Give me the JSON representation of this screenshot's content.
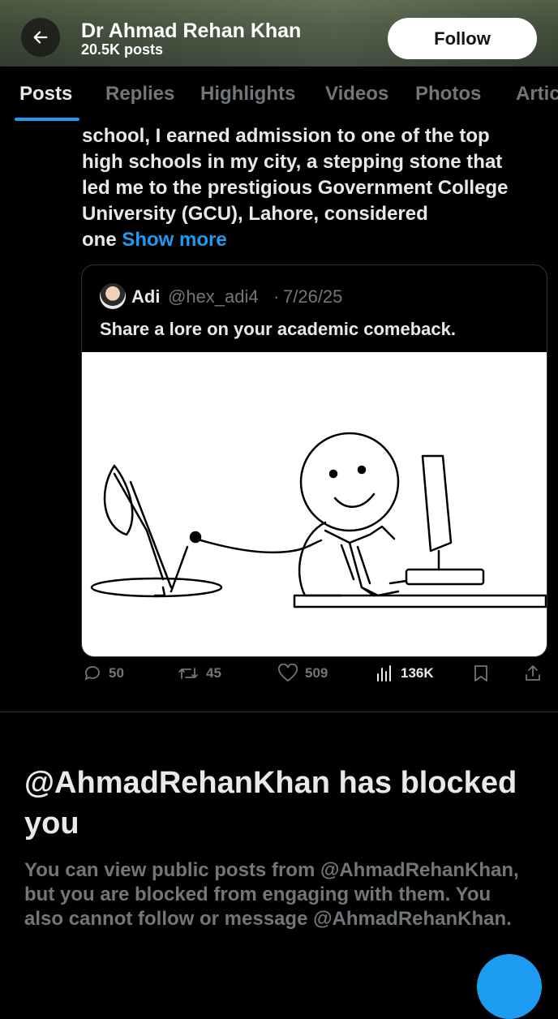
{
  "header": {
    "name": "Dr Ahmad Rehan Khan",
    "posts_count": "20.5K posts",
    "follow_label": "Follow"
  },
  "tabs": [
    {
      "label": "Posts",
      "active": true
    },
    {
      "label": "Replies",
      "active": false
    },
    {
      "label": "Highlights",
      "active": false
    },
    {
      "label": "Videos",
      "active": false
    },
    {
      "label": "Photos",
      "active": false
    },
    {
      "label": "Artic",
      "active": false
    }
  ],
  "post": {
    "lines": [
      "school, I earned admission to one of the top",
      "high schools in my city, a stepping stone that",
      "led me to the prestigious Government College",
      "University (GCU), Lahore, considered"
    ],
    "last_word": "one",
    "show_more": "Show more"
  },
  "quote": {
    "name": "Adi",
    "handle": "@hex_adi4",
    "dot": "·",
    "date": "7/26/25",
    "text": "Share a lore on your academic comeback."
  },
  "actions": {
    "replies": "50",
    "reposts": "45",
    "likes": "509",
    "views": "136K"
  },
  "blocked": {
    "title": "@AhmadRehanKhan has blocked you",
    "description": "You can view public posts from @AhmadRehanKhan, but you are blocked from engaging with them. You also cannot follow or message @AhmadRehanKhan."
  },
  "colors": {
    "accent": "#1d9bf0",
    "muted": "#71767b",
    "text": "#e7e9ea"
  }
}
